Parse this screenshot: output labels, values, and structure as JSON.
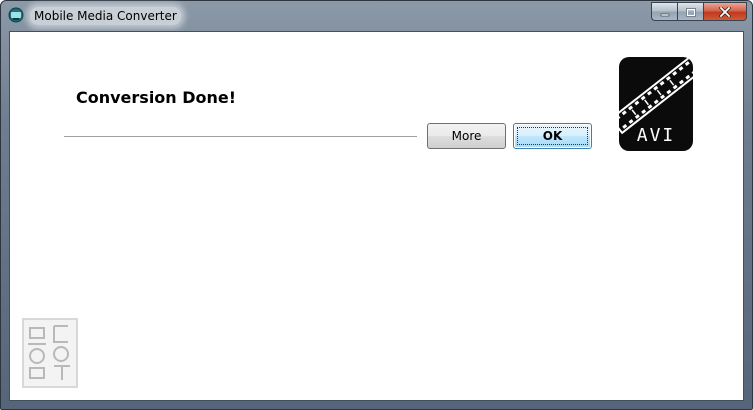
{
  "window": {
    "title": "Mobile Media Converter",
    "icon": "app-icon",
    "controls": [
      "minimize-icon",
      "maximize-icon",
      "close-icon"
    ]
  },
  "dialog": {
    "heading": "Conversion Done!",
    "more_label": "More",
    "ok_label": "OK"
  },
  "format_badge": {
    "label": "AVI",
    "icon": "film-strip-icon"
  },
  "logo": {
    "icon": "watermark-logo"
  },
  "colors": {
    "ok_border": "#3c7fb1",
    "close_button": "#c1391e",
    "badge_background": "#0b0b0b"
  }
}
